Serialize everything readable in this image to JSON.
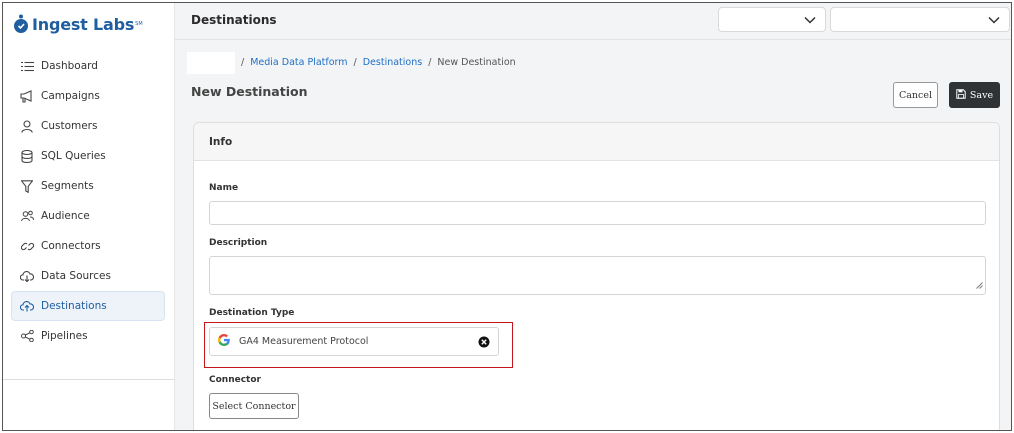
{
  "brand": {
    "name": "Ingest Labs",
    "trademark": "SM",
    "color": "#1f5fa0"
  },
  "sidebar": {
    "items": [
      {
        "label": "Dashboard",
        "icon": "list-icon"
      },
      {
        "label": "Campaigns",
        "icon": "megaphone-icon"
      },
      {
        "label": "Customers",
        "icon": "user-icon"
      },
      {
        "label": "SQL Queries",
        "icon": "database-icon"
      },
      {
        "label": "Segments",
        "icon": "filter-icon"
      },
      {
        "label": "Audience",
        "icon": "users-icon"
      },
      {
        "label": "Connectors",
        "icon": "link-icon"
      },
      {
        "label": "Data Sources",
        "icon": "cloud-download-icon"
      },
      {
        "label": "Destinations",
        "icon": "cloud-upload-icon",
        "active": true
      },
      {
        "label": "Pipelines",
        "icon": "share-nodes-icon"
      }
    ]
  },
  "header": {
    "title": "Destinations",
    "select_1": {
      "value": ""
    },
    "select_2": {
      "value": ""
    }
  },
  "breadcrumb": {
    "separator": "/",
    "items": [
      "Media Data Platform",
      "Destinations",
      "New Destination"
    ]
  },
  "page": {
    "title": "New Destination",
    "cancel_label": "Cancel",
    "save_label": "Save"
  },
  "form": {
    "section_title": "Info",
    "name": {
      "label": "Name",
      "value": ""
    },
    "description": {
      "label": "Description",
      "value": ""
    },
    "destination_type": {
      "label": "Destination Type",
      "value": "GA4 Measurement Protocol",
      "icon": "google-icon"
    },
    "connector": {
      "label": "Connector",
      "button_label": "Select Connector"
    }
  },
  "colors": {
    "accent": "#1f6fc6",
    "highlight_border": "#c4161c",
    "save_button": "#2f3336"
  }
}
